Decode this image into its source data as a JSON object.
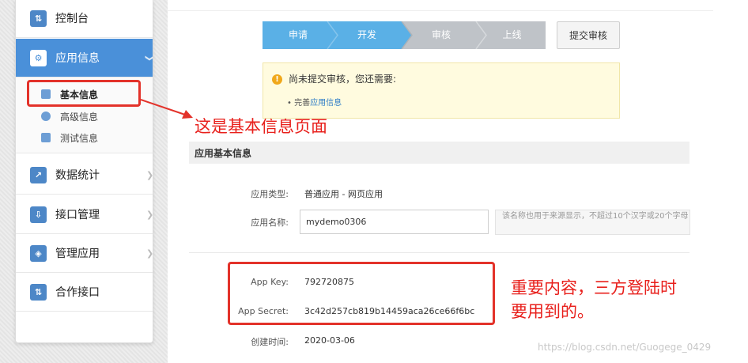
{
  "sidebar": {
    "items": [
      {
        "label": "控制台",
        "icon": "console-icon"
      },
      {
        "label": "应用信息",
        "icon": "app-info-icon"
      },
      {
        "label": "数据统计",
        "icon": "chart-icon"
      },
      {
        "label": "接口管理",
        "icon": "api-icon"
      },
      {
        "label": "管理应用",
        "icon": "layers-icon"
      },
      {
        "label": "合作接口",
        "icon": "partner-icon"
      }
    ],
    "sub_items": [
      {
        "label": "基本信息",
        "icon": "card-icon"
      },
      {
        "label": "高级信息",
        "icon": "info-icon"
      },
      {
        "label": "测试信息",
        "icon": "test-icon"
      }
    ]
  },
  "stepper": {
    "steps": [
      "申请",
      "开发",
      "审核",
      "上线"
    ],
    "active_color": "#5ab0e6",
    "inactive_color": "#bfc3c8"
  },
  "submit_button": "提交审核",
  "notice": {
    "text": "尚未提交审核，您还需要:",
    "bullet_prefix": "• 完善",
    "bullet_link": "应用信息"
  },
  "section": {
    "title": "应用基本信息",
    "app_type_label": "应用类型:",
    "app_type_value": "普通应用 - 网页应用",
    "app_name_label": "应用名称:",
    "app_name_value": "mydemo0306",
    "app_name_hint": "该名称也用于来源显示，不超过10个汉字或20个字母",
    "app_key_label": "App Key:",
    "app_key_value": "792720875",
    "app_secret_label": "App Secret:",
    "app_secret_value": "3c42d257cb819b14459aca26ce66f6bc",
    "created_label": "创建时间:",
    "created_value": "2020-03-06"
  },
  "annotations": {
    "basic_info_note": "这是基本信息页面",
    "key_note_line1": "重要内容，三方登陆时",
    "key_note_line2": "要用到的。",
    "color": "#e3322a"
  },
  "watermark": "https://blog.csdn.net/Guogege_0429"
}
